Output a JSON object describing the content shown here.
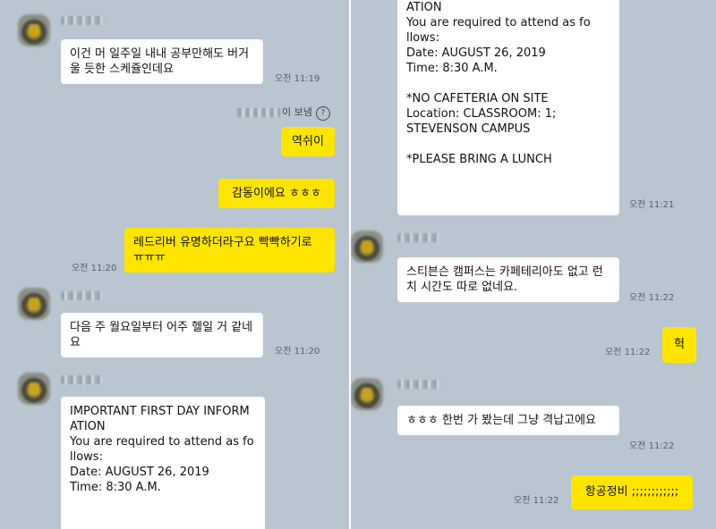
{
  "left": {
    "m1": {
      "text": "이건 머 일주일 내내 공부만해도 버거울 듯한 스케쥴인데요",
      "time": "오전 11:19"
    },
    "system": {
      "suffix": "이 보냄",
      "help": "?"
    },
    "m2": {
      "text": "역쉬이"
    },
    "m3": {
      "text": "감동이에요 ㅎㅎㅎ"
    },
    "m4": {
      "text": "레드리버 유명하더라구요 빡빡하기로 ㅠㅠㅠ",
      "time": "오전 11:20"
    },
    "m5": {
      "text": "다음 주 월요일부터 어주 헬일 거 같네요",
      "time": "오전 11:20"
    },
    "m6": {
      "lines": [
        "IMPORTANT FIRST DAY INFORM",
        "ATION",
        "You are required to attend as fo",
        "llows:",
        "Date: AUGUST 26, 2019",
        "Time: 8:30 A.M."
      ]
    }
  },
  "right": {
    "m1": {
      "lines": [
        "ATION",
        "You are required to attend as fo",
        "llows:",
        "Date: AUGUST 26, 2019",
        "Time: 8:30 A.M.",
        "",
        "*NO CAFETERIA ON SITE",
        "Location: CLASSROOM: 1;",
        "STEVENSON CAMPUS",
        "",
        "*PLEASE BRING A LUNCH"
      ],
      "time": "오전 11:21"
    },
    "m2": {
      "text": "스티븐슨 캠퍼스는 카페테리아도 없고 런치 시간도 따로 없네요.",
      "time": "오전 11:22"
    },
    "m3": {
      "text": "헉",
      "time": "오전 11:22"
    },
    "m4": {
      "text": "ㅎㅎㅎ 한번 가 봤는데 그냥 격납고에요",
      "time": "오전 11:22"
    },
    "m5": {
      "text": "항공정비 ;;;;;;;;;;;;",
      "time": "오전 11:22"
    }
  }
}
